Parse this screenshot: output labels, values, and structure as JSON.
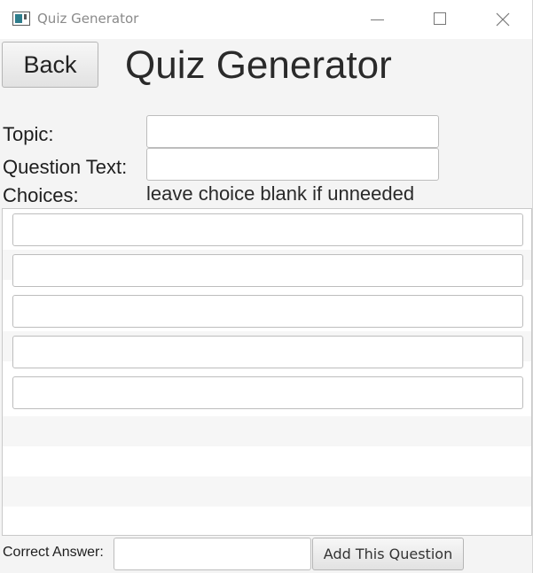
{
  "window": {
    "title": "Quiz Generator"
  },
  "header": {
    "back_label": "Back",
    "title": "Quiz Generator"
  },
  "form": {
    "topic_label": "Topic:",
    "topic_value": "",
    "question_label": "Question Text:",
    "question_value": "",
    "choices_label": "Choices:",
    "choices_hint": "leave choice blank if unneeded",
    "choices": [
      "",
      "",
      "",
      "",
      ""
    ]
  },
  "footer": {
    "correct_answer_label": "Correct Answer:",
    "correct_answer_value": "",
    "add_label": "Add This Question"
  }
}
